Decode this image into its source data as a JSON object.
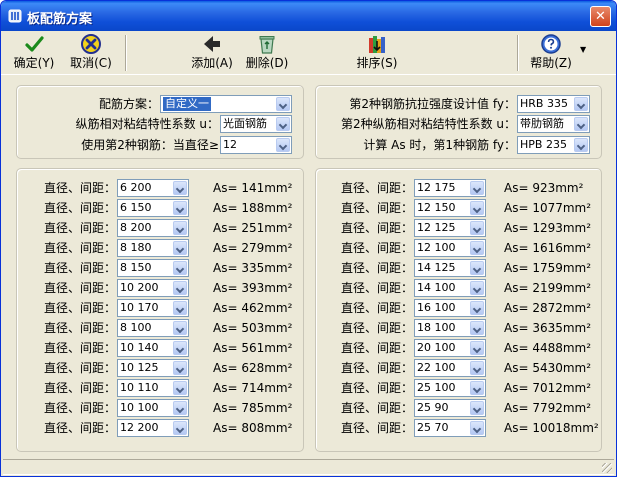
{
  "window": {
    "title": "板配筋方案",
    "close_glyph": "✕",
    "colors": {
      "titlebar": "#0a5be0",
      "face": "#ece9d8",
      "selection": "#316ac5"
    }
  },
  "toolbar": {
    "items": [
      {
        "label": "确定(Y)",
        "icon": "check-icon"
      },
      {
        "label": "取消(C)",
        "icon": "cancel-icon"
      },
      {
        "label": "添加(A)",
        "icon": "add-arrow-icon"
      },
      {
        "label": "删除(D)",
        "icon": "recycle-bin-icon"
      },
      {
        "label": "排序(S)",
        "icon": "sort-books-icon"
      },
      {
        "label": "帮助(Z)",
        "icon": "help-icon"
      }
    ]
  },
  "settings_left": {
    "scheme_label": "配筋方案：",
    "scheme_value": "自定义一",
    "bond_label": "纵筋相对粘结特性系数 u：",
    "bond_value": "光面钢筋",
    "second_label": "使用第2种钢筋：当直径≥",
    "second_value": "12"
  },
  "settings_right": {
    "fy2_label": "第2种钢筋抗拉强度设计值 fy：",
    "fy2_value": "HRB 335",
    "bond2_label": "第2种纵筋相对粘结特性系数 u：",
    "bond2_value": "带肋钢筋",
    "fy1_label": "计算 As 时，第1种钢筋 fy：",
    "fy1_value": "HPB 235"
  },
  "rebar_label": "直径、间距：",
  "rebar_left": [
    {
      "value": "6 200",
      "as": "As= 141mm²"
    },
    {
      "value": "6 150",
      "as": "As= 188mm²"
    },
    {
      "value": "8 200",
      "as": "As= 251mm²"
    },
    {
      "value": "8 180",
      "as": "As= 279mm²"
    },
    {
      "value": "8 150",
      "as": "As= 335mm²"
    },
    {
      "value": "10 200",
      "as": "As= 393mm²"
    },
    {
      "value": "10 170",
      "as": "As= 462mm²"
    },
    {
      "value": "8 100",
      "as": "As= 503mm²"
    },
    {
      "value": "10 140",
      "as": "As= 561mm²"
    },
    {
      "value": "10 125",
      "as": "As= 628mm²"
    },
    {
      "value": "10 110",
      "as": "As= 714mm²"
    },
    {
      "value": "10 100",
      "as": "As= 785mm²"
    },
    {
      "value": "12 200",
      "as": "As= 808mm²"
    }
  ],
  "rebar_right": [
    {
      "value": "12 175",
      "as": "As= 923mm²"
    },
    {
      "value": "12 150",
      "as": "As= 1077mm²"
    },
    {
      "value": "12 125",
      "as": "As= 1293mm²"
    },
    {
      "value": "12 100",
      "as": "As= 1616mm²"
    },
    {
      "value": "14 125",
      "as": "As= 1759mm²"
    },
    {
      "value": "14 100",
      "as": "As= 2199mm²"
    },
    {
      "value": "16 100",
      "as": "As= 2872mm²"
    },
    {
      "value": "18 100",
      "as": "As= 3635mm²"
    },
    {
      "value": "20 100",
      "as": "As= 4488mm²"
    },
    {
      "value": "22 100",
      "as": "As= 5430mm²"
    },
    {
      "value": "25 100",
      "as": "As= 7012mm²"
    },
    {
      "value": "25 90",
      "as": "As= 7792mm²"
    },
    {
      "value": "25 70",
      "as": "As= 10018mm²"
    }
  ]
}
